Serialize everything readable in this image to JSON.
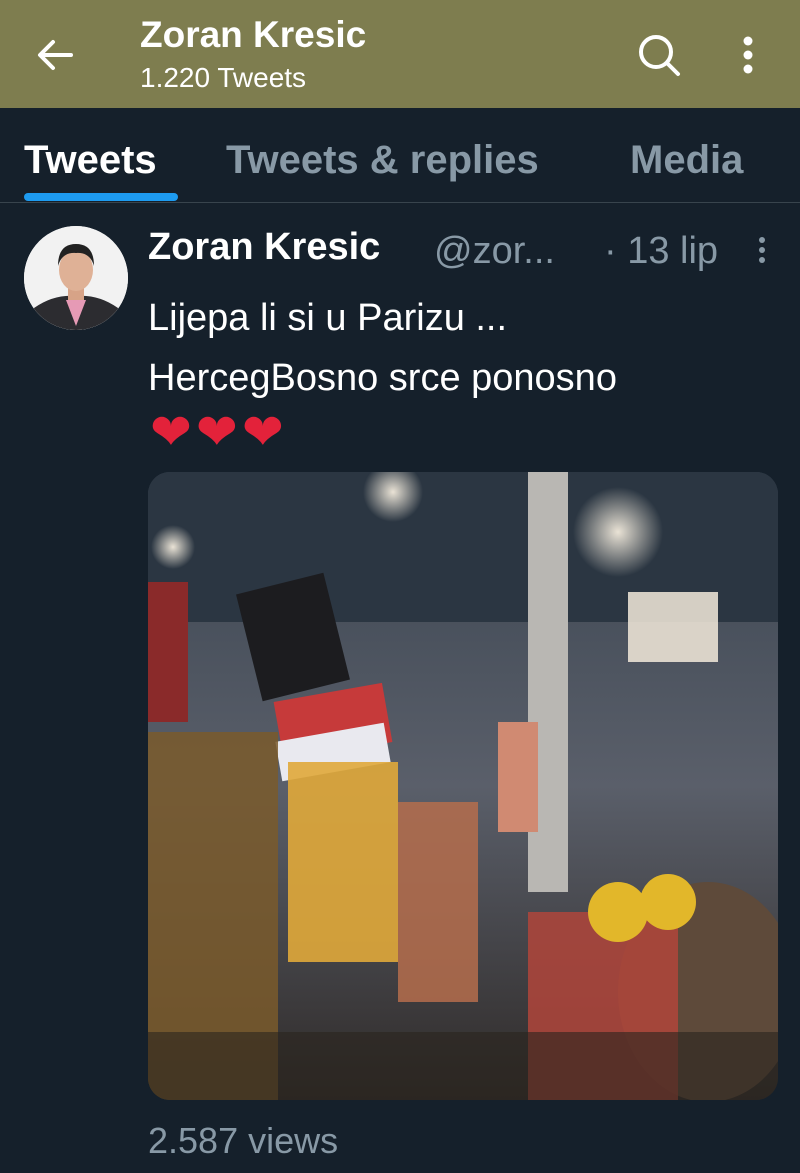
{
  "header": {
    "title": "Zoran Kresic",
    "subtitle": "1.220 Tweets",
    "background": "#7e7d4f",
    "icons": [
      "back-arrow-icon",
      "search-icon",
      "more-vertical-icon"
    ]
  },
  "tabs": [
    {
      "label": "Tweets",
      "active": true
    },
    {
      "label": "Tweets & replies",
      "active": false
    },
    {
      "label": "Media",
      "active": false
    }
  ],
  "tweet": {
    "author": "Zoran Kresic",
    "handle": "@zor...",
    "date": "· 13 lip",
    "text_lines": [
      "Lijepa li si u Parizu ...",
      "HercegBosno srce ponosno"
    ],
    "emoji": [
      "❤",
      "❤",
      "❤"
    ],
    "views": "2.587 views",
    "media_type": "video"
  },
  "colors": {
    "background": "#15202b",
    "accent": "#1d9bf0",
    "muted_text": "#8899a6",
    "heart": "#e3223a"
  }
}
